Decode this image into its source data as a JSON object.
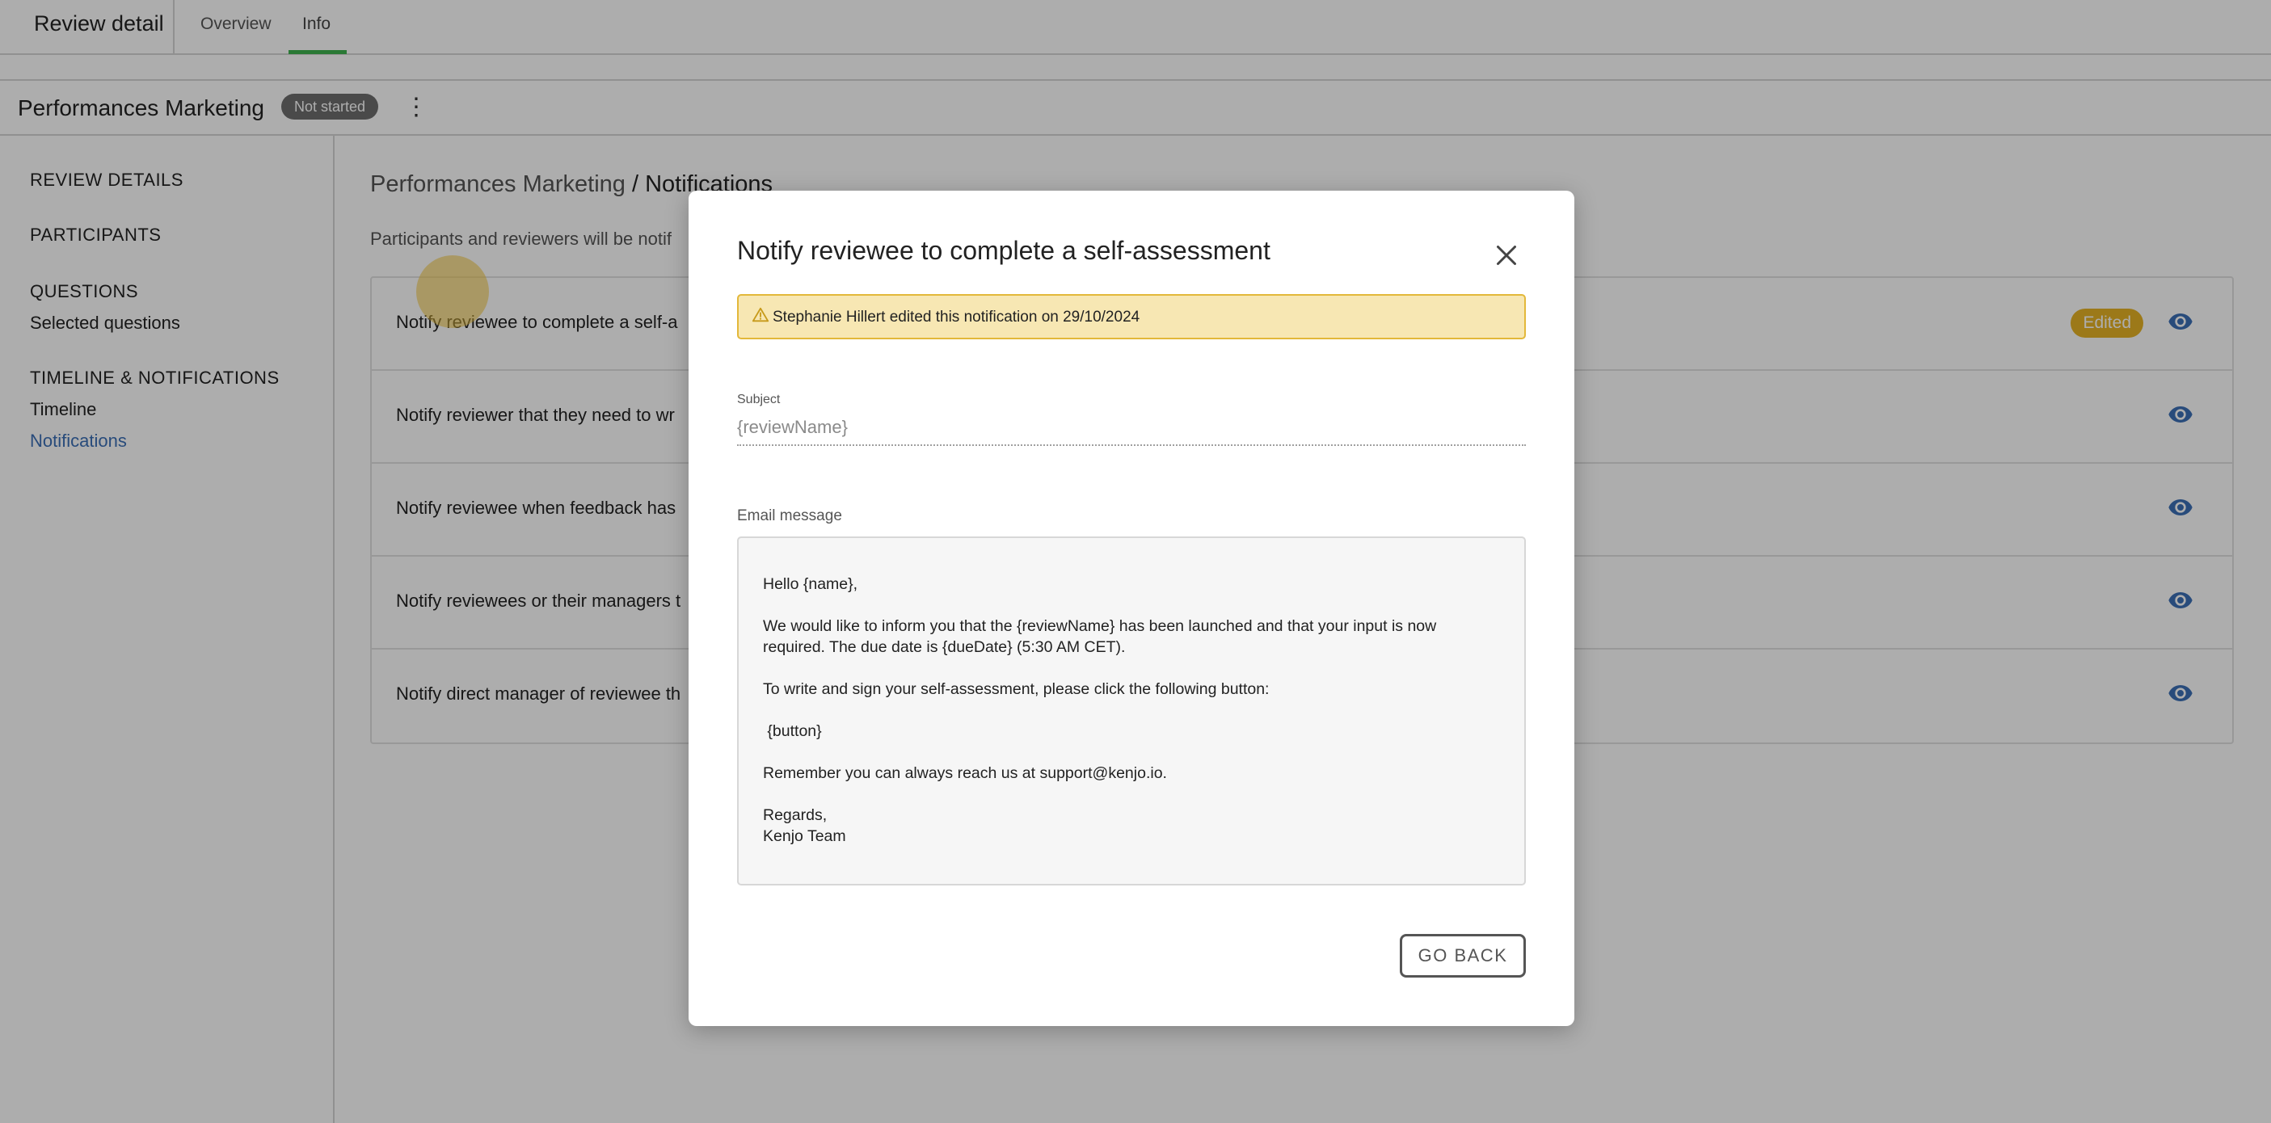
{
  "header": {
    "title": "Review detail",
    "tabs": [
      {
        "label": "Overview"
      },
      {
        "label": "Info"
      }
    ]
  },
  "review": {
    "name": "Performances Marketing",
    "status": "Not started"
  },
  "sidebar": {
    "sections": [
      {
        "label": "REVIEW DETAILS"
      },
      {
        "label": "PARTICIPANTS"
      },
      {
        "label": "QUESTIONS"
      },
      {
        "label": "TIMELINE & NOTIFICATIONS"
      }
    ],
    "subitems": [
      {
        "label": "Selected questions"
      },
      {
        "label": "Timeline"
      },
      {
        "label": "Notifications"
      }
    ]
  },
  "main": {
    "breadcrumb_parent": "Performances Marketing",
    "breadcrumb_current": "/ Notifications",
    "description": "Participants and reviewers will be notif",
    "rows": [
      {
        "label": "Notify reviewee to complete a self-a",
        "badge": "Edited"
      },
      {
        "label": "Notify reviewer that they need to wr"
      },
      {
        "label": "Notify reviewee when feedback has"
      },
      {
        "label": "Notify reviewees or their managers t"
      },
      {
        "label": "Notify direct manager of reviewee th"
      }
    ]
  },
  "modal": {
    "title": "Notify reviewee to complete a self-assessment",
    "warning": "Stephanie Hillert edited this notification on 29/10/2024",
    "subject_label": "Subject",
    "subject_value": "{reviewName}",
    "email_label": "Email message",
    "email_lines": [
      "Hello {name},",
      "",
      "We would like to inform you that the {reviewName} has been launched and that your input is now",
      "required. The due date is {dueDate} (5:30 AM CET).",
      "",
      "To write and sign your self-assessment, please click the following button:",
      "",
      " {button}",
      "",
      "Remember you can always reach us at support@kenjo.io.",
      "",
      "Regards,",
      "Kenjo Team"
    ],
    "go_back_label": "GO BACK"
  },
  "colors": {
    "accent_blue": "#3b6fb6",
    "tab_underline": "#3fb34f",
    "edited_badge": "#e6b325",
    "warning_bg": "#f7e7b3"
  },
  "icons": {
    "more": "more-vertical-icon",
    "eye": "eye-icon",
    "close": "close-icon",
    "warning": "warning-icon"
  }
}
